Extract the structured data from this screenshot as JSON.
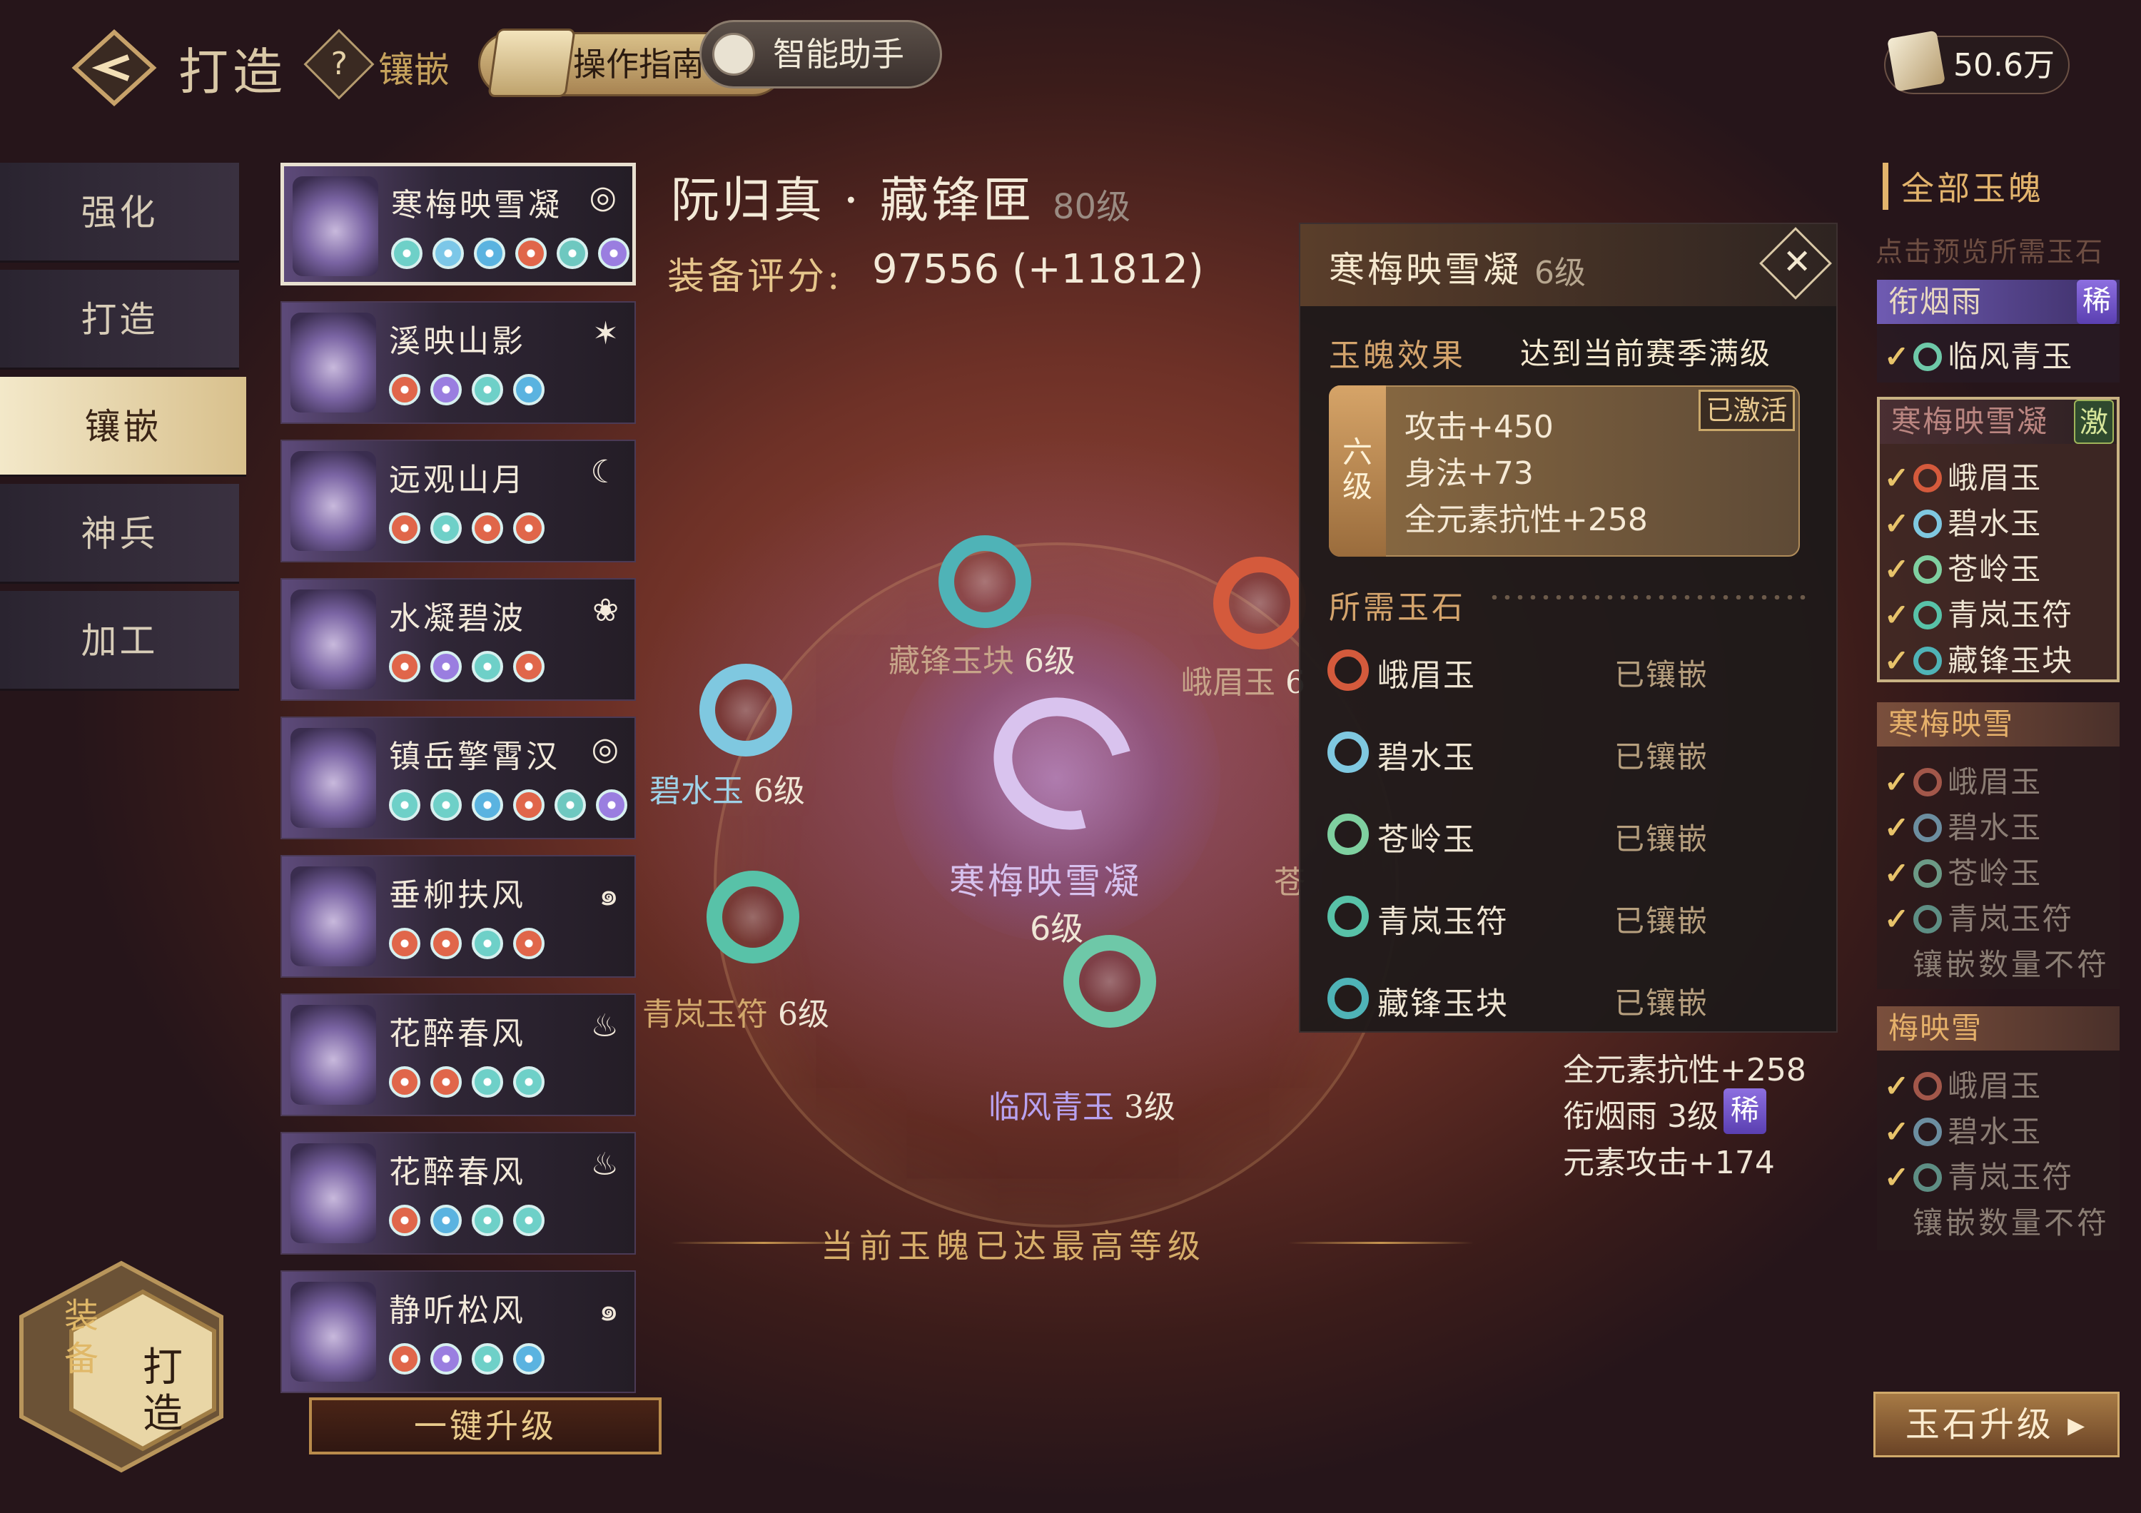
{
  "header": {
    "title": "打造",
    "tab_inlay": "镶嵌",
    "guide_label": "操作指南",
    "assistant_label": "智能助手",
    "currency_value": "50.6万"
  },
  "nav": {
    "items": [
      "强化",
      "打造",
      "镶嵌",
      "神兵",
      "加工"
    ],
    "active_index": 2,
    "bottom_equip": "装备",
    "bottom_forge": "打造"
  },
  "equipment_list": [
    {
      "name": "寒梅映雪凝",
      "element_icon": "swirl-icon",
      "gems": [
        "#6ed0c8",
        "#7cc7e8",
        "#5ab3e0",
        "#e0664a",
        "#6ec8c0",
        "#9a7ee0"
      ]
    },
    {
      "name": "溪映山影",
      "element_icon": "star-icon",
      "gems": [
        "#e0664a",
        "#9a7ee0",
        "#6ed0c8",
        "#5ab3e0"
      ]
    },
    {
      "name": "远观山月",
      "element_icon": "moon-icon",
      "gems": [
        "#e0664a",
        "#6ed0c8",
        "#e0664a",
        "#e0664a"
      ]
    },
    {
      "name": "水凝碧波",
      "element_icon": "lotus-icon",
      "gems": [
        "#e0664a",
        "#9a7ee0",
        "#6ed0c8",
        "#e0664a"
      ]
    },
    {
      "name": "镇岳擎霄汉",
      "element_icon": "swirl-icon",
      "gems": [
        "#6ed0c8",
        "#6ed0c8",
        "#5ab3e0",
        "#e0664a",
        "#6ec8c0",
        "#9a7ee0"
      ]
    },
    {
      "name": "垂柳扶风",
      "element_icon": "wind-icon",
      "gems": [
        "#e0664a",
        "#e0664a",
        "#6ed0c8",
        "#e0664a"
      ]
    },
    {
      "name": "花醉春风",
      "element_icon": "flame-icon",
      "gems": [
        "#e0664a",
        "#e0664a",
        "#6ed0c8",
        "#6ed0c8"
      ]
    },
    {
      "name": "花醉春风",
      "element_icon": "flame-icon",
      "gems": [
        "#e0664a",
        "#5ab3e0",
        "#6ed0c8",
        "#6ed0c8"
      ]
    },
    {
      "name": "静听松风",
      "element_icon": "wind-icon",
      "gems": [
        "#e0664a",
        "#9a7ee0",
        "#6ed0c8",
        "#5ab3e0"
      ]
    }
  ],
  "one_key_upgrade": "一键升级",
  "item": {
    "title": "阮归真 · 藏锋匣",
    "level": "80级",
    "score_label": "装备评分:",
    "score_value": "97556 (+11812)"
  },
  "center": {
    "name": "寒梅映雪凝",
    "level": "6级",
    "stones": [
      {
        "label": "藏锋玉块",
        "level": "6级",
        "color": "#4fb3b7"
      },
      {
        "label": "峨眉玉",
        "level": "6",
        "color": "#d45a3c"
      },
      {
        "label": "碧水玉",
        "level": "6级",
        "color": "#7fc8e0"
      },
      {
        "label": "青岚玉符",
        "level": "6级",
        "color": "#58c2a8"
      },
      {
        "label": "临风青玉",
        "level": "3级",
        "color": "#6ec8a8"
      },
      {
        "label": "苍",
        "level": "",
        "color": "#6ec8a8"
      }
    ],
    "max_banner": "当前玉魄已达最高等级"
  },
  "detail": {
    "name": "寒梅映雪凝",
    "level": "6级",
    "effect_label": "玉魄效果",
    "effect_status": "达到当前赛季满级",
    "tier": "六级",
    "activated": "已激活",
    "effects": [
      "攻击+450",
      "身法+73",
      "全元素抗性+258"
    ],
    "required_label": "所需玉石",
    "required": [
      {
        "name": "峨眉玉",
        "status": "已镶嵌",
        "color": "#d45a3c"
      },
      {
        "name": "碧水玉",
        "status": "已镶嵌",
        "color": "#7fc8e0"
      },
      {
        "name": "苍岭玉",
        "status": "已镶嵌",
        "color": "#7fd0a0"
      },
      {
        "name": "青岚玉符",
        "status": "已镶嵌",
        "color": "#58c2a8"
      },
      {
        "name": "藏锋玉块",
        "status": "已镶嵌",
        "color": "#4fb3b7"
      }
    ]
  },
  "bonus": {
    "line1": "全元素抗性+258",
    "line2": "衔烟雨 3级",
    "line2_badge": "稀",
    "line3": "元素攻击+174"
  },
  "right_panel": {
    "all_jade": "全部玉魄",
    "preview_hint": "点击预览所需玉石",
    "groups": [
      {
        "title": "衔烟雨",
        "tag": "稀",
        "items": [
          "临风青玉"
        ],
        "fail": ""
      },
      {
        "title": "寒梅映雪凝",
        "tag": "激",
        "items": [
          "峨眉玉",
          "碧水玉",
          "苍岭玉",
          "青岚玉符",
          "藏锋玉块"
        ],
        "fail": ""
      },
      {
        "title": "寒梅映雪",
        "tag": "",
        "items": [
          "峨眉玉",
          "碧水玉",
          "苍岭玉",
          "青岚玉符"
        ],
        "fail": "镶嵌数量不符"
      },
      {
        "title": "梅映雪",
        "tag": "",
        "items": [
          "峨眉玉",
          "碧水玉",
          "青岚玉符"
        ],
        "fail": "镶嵌数量不符"
      }
    ],
    "upgrade_button": "玉石升级"
  },
  "colors": {
    "accent_gold": "#e3b46c",
    "rare_purple": "#6f5bb2",
    "jade_teal": "#4fb3b7",
    "jade_red": "#d45a3c"
  }
}
